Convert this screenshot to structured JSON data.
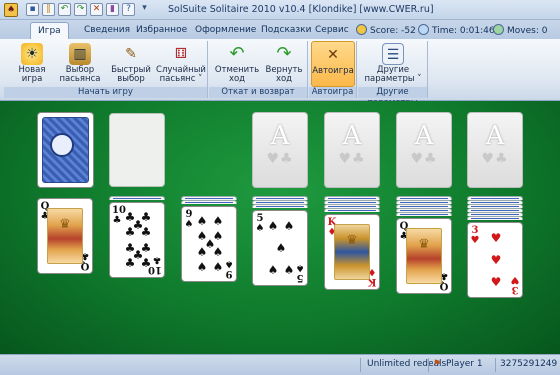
{
  "window": {
    "title": "SolSuite Solitaire 2010 v10.4  [Klondike]  [www.CWER.ru]"
  },
  "tabs": [
    {
      "label": "Игра",
      "active": true
    },
    {
      "label": "Сведения"
    },
    {
      "label": "Избранное"
    },
    {
      "label": "Оформление"
    },
    {
      "label": "Подсказки"
    },
    {
      "label": "Сервис"
    }
  ],
  "stats": {
    "score": "Score: -52",
    "time": "Time: 0:01:46",
    "moves": "Moves: 0"
  },
  "ribbon": {
    "groups": [
      {
        "label": "Начать игру"
      },
      {
        "label": "Откат и возврат"
      },
      {
        "label": "Автоигра"
      },
      {
        "label": "Другие параметры"
      }
    ],
    "buttons": [
      {
        "label1": "Новая",
        "label2": "игра",
        "icon": "sun-icon"
      },
      {
        "label1": "Выбор",
        "label2": "пасьянса",
        "icon": "book-icon"
      },
      {
        "label1": "Быстрый",
        "label2": "выбор",
        "icon": "wand-icon"
      },
      {
        "label1": "Случайный",
        "label2": "пасьянс ˅",
        "icon": "dice-icon"
      },
      {
        "label1": "Отменить",
        "label2": "ход",
        "icon": "undo-icon"
      },
      {
        "label1": "Вернуть",
        "label2": "ход",
        "icon": "redo-icon"
      },
      {
        "label1": "Автоигра",
        "label2": "",
        "icon": "autoplay-icon"
      },
      {
        "label1": "Другие",
        "label2": "параметры ˅",
        "icon": "settings-icon"
      }
    ]
  },
  "foundations": [
    {
      "rank": "A",
      "suits": "♥♣"
    },
    {
      "rank": "A",
      "suits": "♥♣"
    },
    {
      "rank": "A",
      "suits": "♥♣"
    },
    {
      "rank": "A",
      "suits": "♥♣"
    }
  ],
  "tableau": [
    {
      "hidden": 0,
      "rank": "Q",
      "suit": "♣",
      "color": "black",
      "kind": "face"
    },
    {
      "hidden": 1,
      "rank": "10",
      "suit": "♣",
      "color": "black",
      "kind": "pips"
    },
    {
      "hidden": 2,
      "rank": "9",
      "suit": "♠",
      "color": "black",
      "kind": "pips"
    },
    {
      "hidden": 3,
      "rank": "5",
      "suit": "♠",
      "color": "black",
      "kind": "pips"
    },
    {
      "hidden": 4,
      "rank": "K",
      "suit": "♦",
      "color": "red",
      "kind": "face"
    },
    {
      "hidden": 5,
      "rank": "Q",
      "suit": "♣",
      "color": "black",
      "kind": "face"
    },
    {
      "hidden": 6,
      "rank": "3",
      "suit": "♥",
      "color": "red",
      "kind": "pips"
    }
  ],
  "statusbar": {
    "redeals": "Unlimited redeals",
    "player": "Player 1",
    "gameid": "3275291249"
  }
}
